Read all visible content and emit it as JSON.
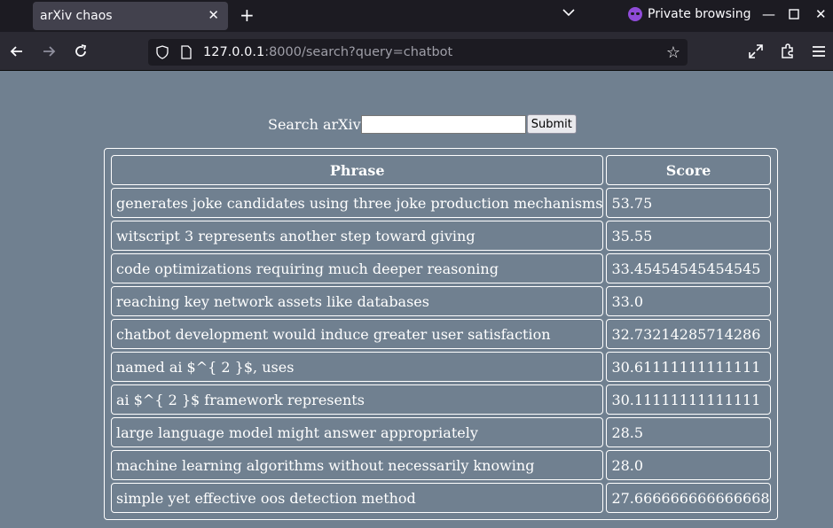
{
  "browser": {
    "tab_title": "arXiv chaos",
    "private_label": "Private browsing",
    "url_host": "127.0.0.1",
    "url_rest": ":8000/search?query=chatbot"
  },
  "search": {
    "label": "Search arXiv",
    "value": "",
    "submit_label": "Submit"
  },
  "table": {
    "headers": [
      "Phrase",
      "Score"
    ],
    "rows": [
      {
        "phrase": "generates joke candidates using three joke production mechanisms",
        "score": "53.75"
      },
      {
        "phrase": "witscript 3 represents another step toward giving",
        "score": "35.55"
      },
      {
        "phrase": "code optimizations requiring much deeper reasoning",
        "score": "33.45454545454545"
      },
      {
        "phrase": "reaching key network assets like databases",
        "score": "33.0"
      },
      {
        "phrase": "chatbot development would induce greater user satisfaction",
        "score": "32.73214285714286"
      },
      {
        "phrase": "named ai $^{ 2 }$, uses",
        "score": "30.61111111111111"
      },
      {
        "phrase": "ai $^{ 2 }$ framework represents",
        "score": "30.11111111111111"
      },
      {
        "phrase": "large language model might answer appropriately",
        "score": "28.5"
      },
      {
        "phrase": "machine learning algorithms without necessarily knowing",
        "score": "28.0"
      },
      {
        "phrase": "simple yet effective oos detection method",
        "score": "27.666666666666668"
      }
    ]
  },
  "colors": {
    "page_background": "#708090",
    "chrome_dark": "#1c1b22",
    "toolbar": "#2b2a33",
    "private_accent": "#8f4bd8"
  },
  "icons": [
    "close-icon",
    "plus-icon",
    "chevron-down-icon",
    "private-mask-icon",
    "minimize-icon",
    "maximize-icon",
    "window-close-icon",
    "back-arrow-icon",
    "forward-arrow-icon",
    "reload-icon",
    "shield-icon",
    "page-icon",
    "star-icon",
    "expand-icon",
    "extensions-icon",
    "menu-icon"
  ]
}
